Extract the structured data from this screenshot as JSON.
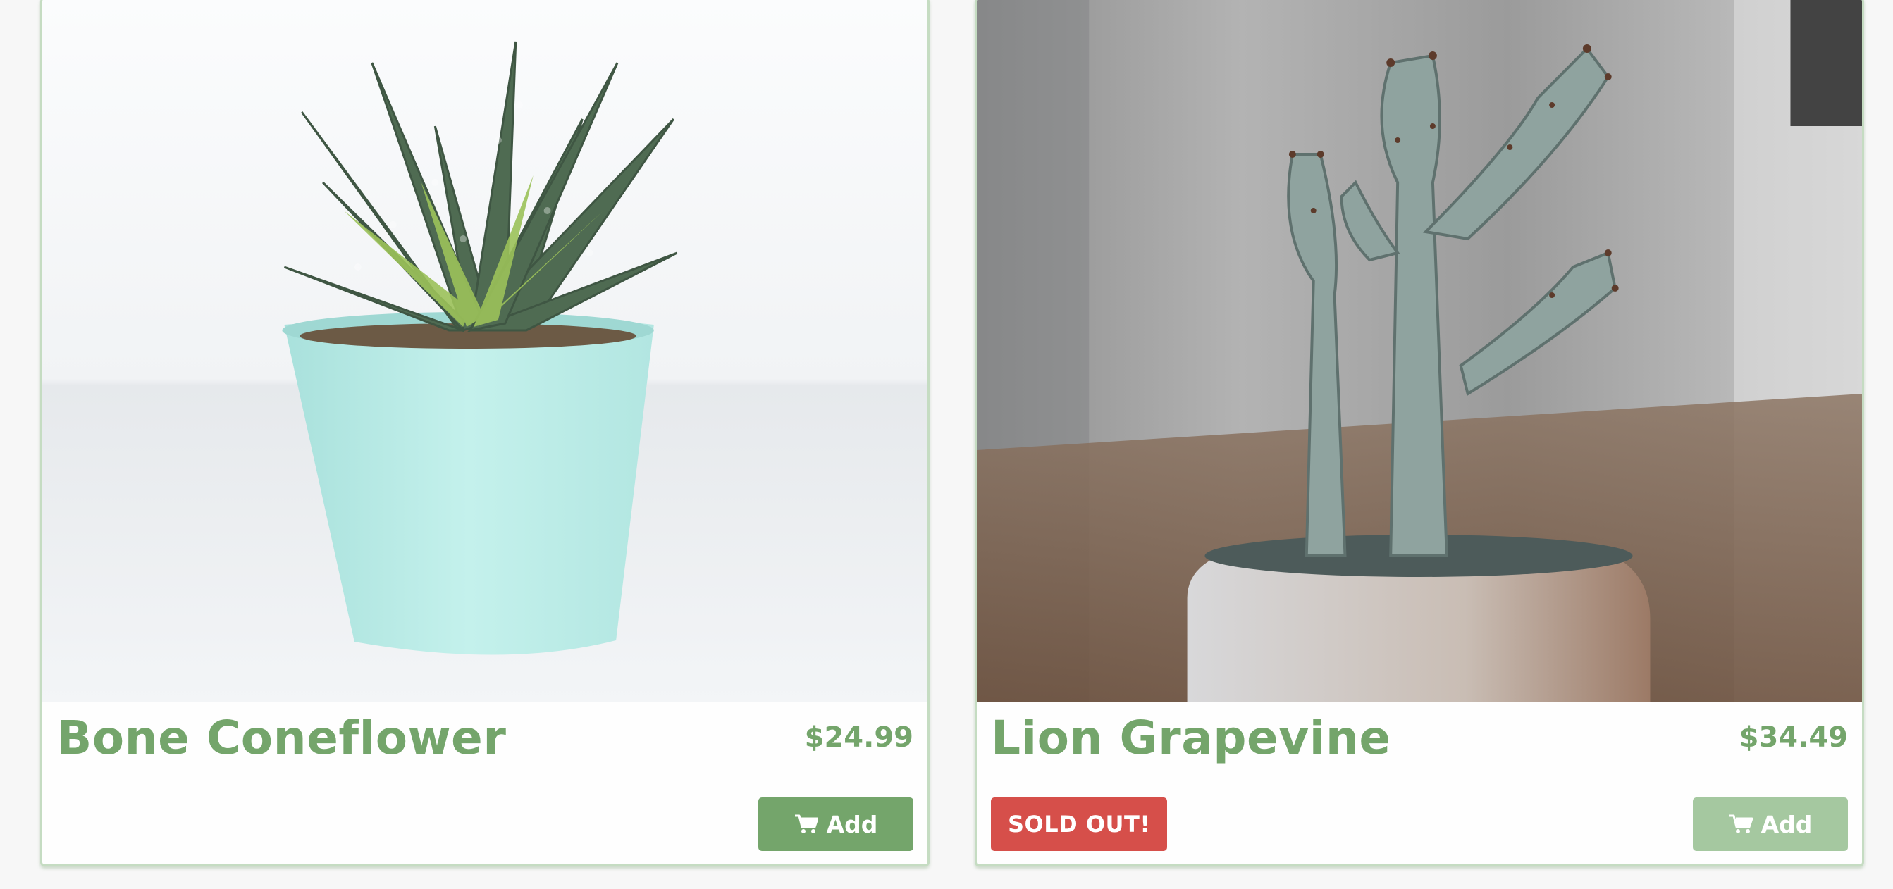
{
  "products": [
    {
      "name": "Bone Coneflower",
      "price": "$24.99",
      "add_label": "Add",
      "photo_subject": "succulent-in-mint-pot",
      "sold_out": false
    },
    {
      "name": "Lion Grapevine",
      "price": "$34.49",
      "add_label": "Add",
      "badge": "SOLD OUT!",
      "photo_subject": "cactus-in-round-pot",
      "sold_out": true
    }
  ],
  "colors": {
    "accent": "#74a56b",
    "accent_disabled": "#a5c8a0",
    "sold_out": "#d64f4a",
    "card_border": "#c5dcc2"
  },
  "icons": {
    "add_button": "cart-icon"
  }
}
